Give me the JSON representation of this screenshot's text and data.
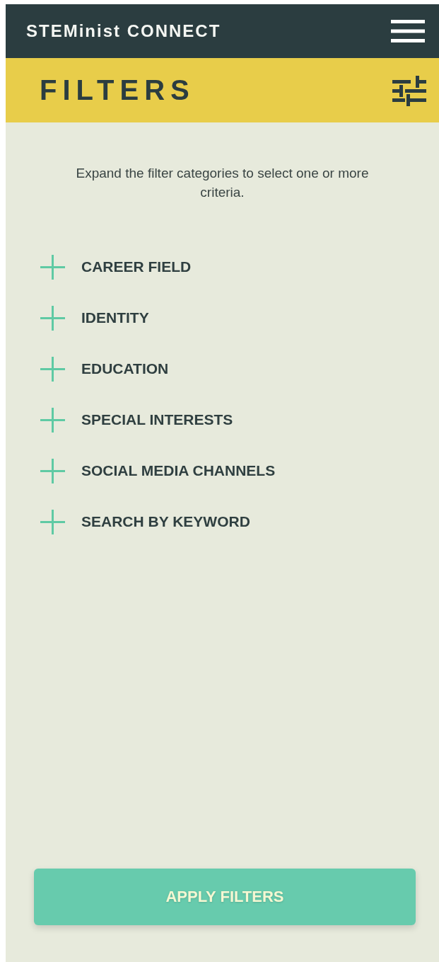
{
  "app_bar": {
    "title": "STEMinist CONNECT"
  },
  "filters_header": {
    "title": "FILTERS"
  },
  "intro": "Expand the filter categories to select one or more criteria.",
  "categories": [
    {
      "label": "CAREER FIELD",
      "expanded": false
    },
    {
      "label": "IDENTITY",
      "expanded": false
    },
    {
      "label": "EDUCATION",
      "expanded": false
    },
    {
      "label": "SPECIAL INTERESTS",
      "expanded": false
    },
    {
      "label": "SOCIAL MEDIA CHANNELS",
      "expanded": false
    },
    {
      "label": "SEARCH BY KEYWORD",
      "expanded": false
    }
  ],
  "apply_button": "APPLY FILTERS"
}
